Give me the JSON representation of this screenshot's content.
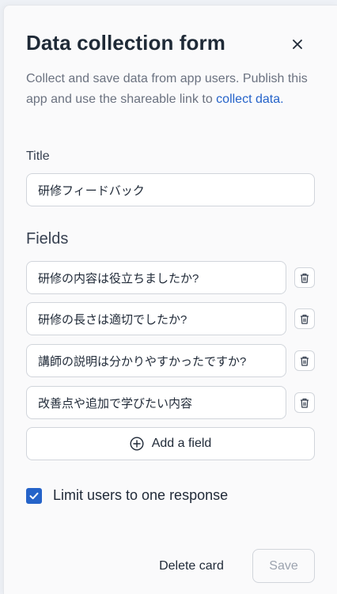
{
  "panel": {
    "title": "Data collection form",
    "description": "Collect and save data from app users. Publish this app and use the shareable link to ",
    "description_link": "collect data."
  },
  "title_field": {
    "label": "Title",
    "value": "研修フィードバック"
  },
  "fields": {
    "label": "Fields",
    "items": [
      {
        "value": "研修の内容は役立ちましたか?"
      },
      {
        "value": "研修の長さは適切でしたか?"
      },
      {
        "value": "講師の説明は分かりやすかったですか?"
      },
      {
        "value": "改善点や追加で学びたい内容"
      }
    ],
    "add_label": "Add a field"
  },
  "limit": {
    "label": "Limit users to one response",
    "checked": true
  },
  "footer": {
    "delete_label": "Delete card",
    "save_label": "Save"
  },
  "colors": {
    "accent": "#2563c9",
    "panel_bg": "#fafafb",
    "border": "#d1d5db"
  },
  "icons": [
    "close-icon",
    "trash-icon",
    "plus-circle-icon",
    "checkmark-icon"
  ]
}
